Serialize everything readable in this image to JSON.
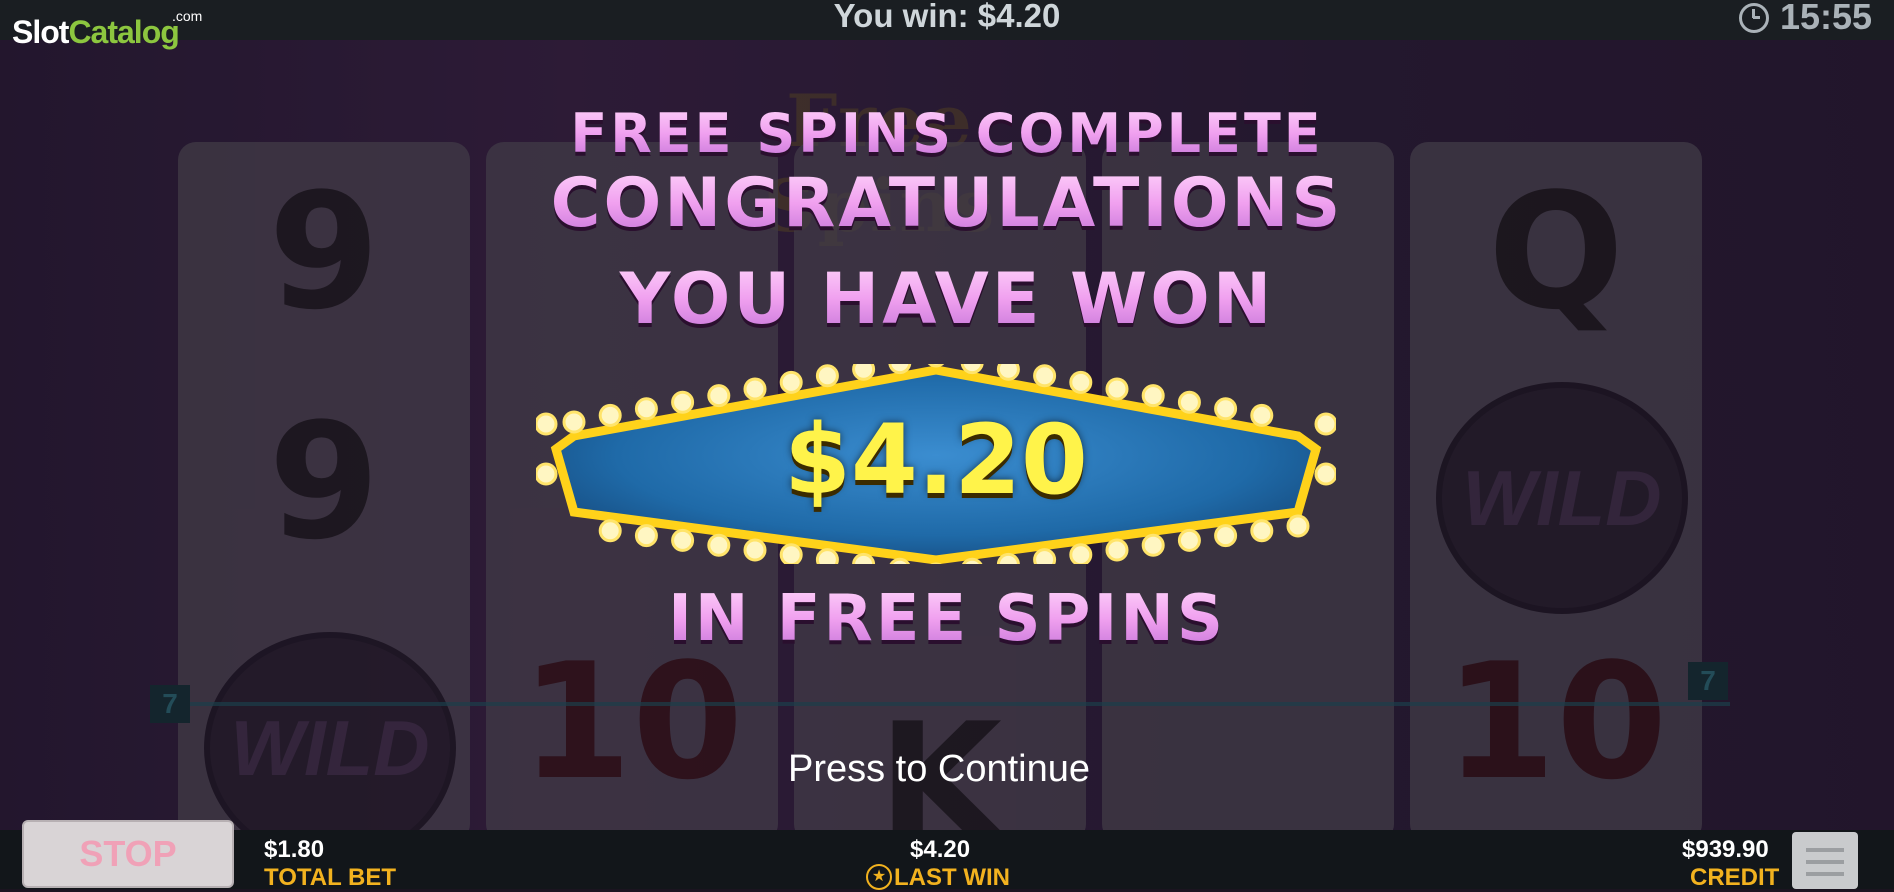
{
  "topbar": {
    "logo_slot": "Slot",
    "logo_catalog": "Catalog",
    "logo_com": ".com",
    "win_text": "You win: $4.20",
    "time": "15:55"
  },
  "background": {
    "banner": "Free Spins",
    "reel_symbols": [
      "9",
      "9",
      "WILD",
      "10",
      "K",
      "Q",
      "WILD",
      "10"
    ],
    "payline_marker": "7"
  },
  "popup": {
    "line1": "FREE SPINS COMPLETE",
    "line2": "CONGRATULATIONS",
    "line3": "YOU HAVE WON",
    "amount": "$4.20",
    "line4": "IN FREE SPINS",
    "continue": "Press to Continue"
  },
  "bottombar": {
    "stop_label": "STOP",
    "total_bet_value": "$1.80",
    "total_bet_label": "TOTAL BET",
    "last_win_value": "$4.20",
    "last_win_label": "LAST WIN",
    "credit_value": "$939.90",
    "credit_label": "CREDIT"
  },
  "colors": {
    "headline": "#f2a5f0",
    "amount": "#fff34a",
    "label": "#f2b21f",
    "sign_fill": "#1f6aa8",
    "sign_border": "#ffd21a"
  }
}
